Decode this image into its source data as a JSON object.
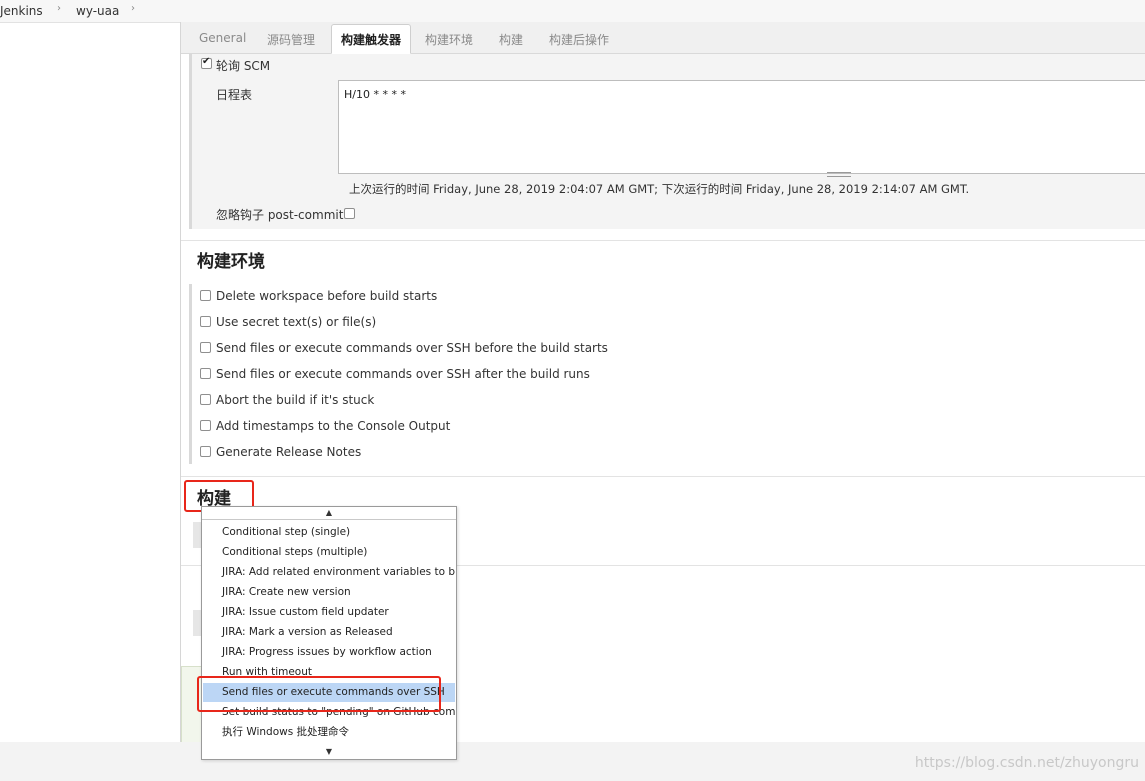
{
  "breadcrumb": {
    "items": [
      "Jenkins",
      "wy-uaa"
    ]
  },
  "tabs": [
    {
      "label": "General",
      "active": false
    },
    {
      "label": "源码管理",
      "active": false
    },
    {
      "label": "构建触发器",
      "active": true
    },
    {
      "label": "构建环境",
      "active": false
    },
    {
      "label": "构建",
      "active": false
    },
    {
      "label": "构建后操作",
      "active": false
    }
  ],
  "triggers": {
    "poll_scm_label": "轮询 SCM",
    "poll_scm_checked": true,
    "schedule_label": "日程表",
    "schedule_value": "H/10 * * * *",
    "schedule_info": "上次运行的时间 Friday, June 28, 2019 2:04:07 AM GMT; 下次运行的时间 Friday, June 28, 2019 2:14:07 AM GMT.",
    "ignore_hooks_label": "忽略钩子 post-commit",
    "ignore_hooks_checked": false
  },
  "build_env": {
    "title": "构建环境",
    "options": [
      "Delete workspace before build starts",
      "Use secret text(s) or file(s)",
      "Send files or execute commands over SSH before the build starts",
      "Send files or execute commands over SSH after the build runs",
      "Abort the build if it's stuck",
      "Add timestamps to the Console Output",
      "Generate Release Notes"
    ]
  },
  "build": {
    "title": "构建"
  },
  "dropdown": {
    "items": [
      "Conditional step (single)",
      "Conditional steps (multiple)",
      "JIRA: Add related environment variables to build",
      "JIRA: Create new version",
      "JIRA: Issue custom field updater",
      "JIRA: Mark a version as Released",
      "JIRA: Progress issues by workflow action",
      "Run with timeout",
      "Send files or execute commands over SSH",
      "Set build status to \"pending\" on GitHub commit",
      "执行 Windows 批处理命令"
    ],
    "selected_index": 8,
    "scroll_up_glyph": "▲",
    "scroll_down_glyph": "▼"
  },
  "watermark": "https://blog.csdn.net/zhuyongru",
  "colors": {
    "highlight": "#e8261a",
    "selected_item": "#bcd6f5"
  }
}
